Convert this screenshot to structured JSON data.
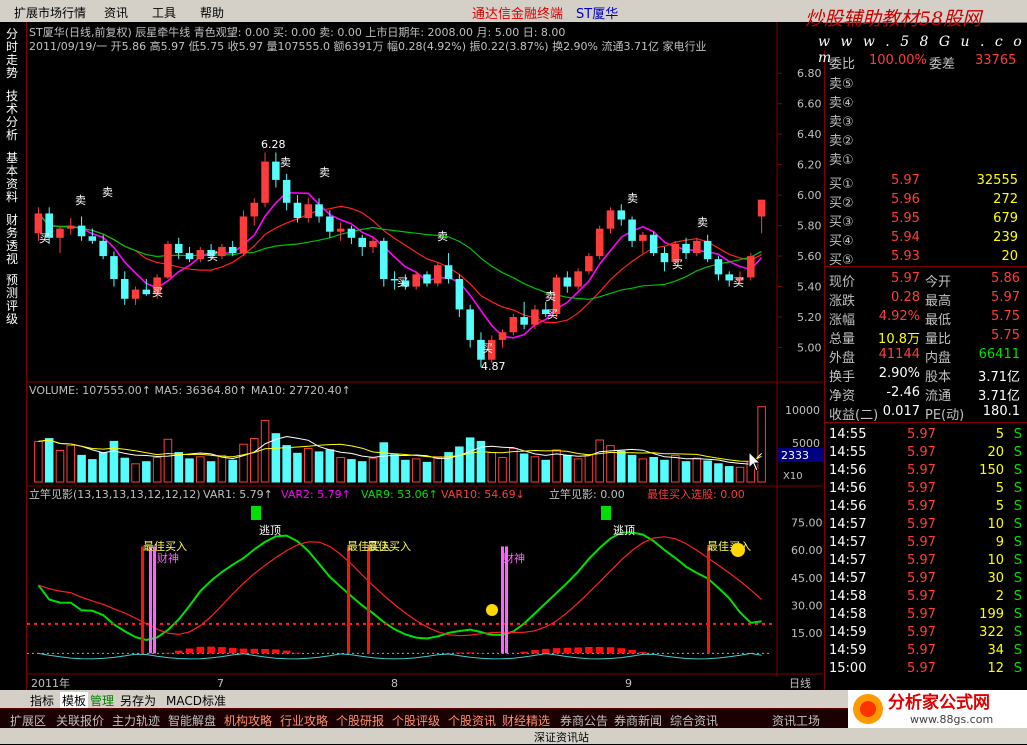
{
  "menu": {
    "items": [
      "扩展市场行情",
      "资讯",
      "工具",
      "帮助"
    ],
    "brand": "通达信金融终端",
    "stock": "ST厦华"
  },
  "watermark": {
    "top": "炒股辅助教材58股网",
    "url": "w w w . 5 8 G u . c o m"
  },
  "side_tabs": [
    "分时走势",
    "技术分析",
    "基本资料",
    "财务透视",
    "预测评级"
  ],
  "chart_header": {
    "line1": "ST厦华(日线,前复权) 辰星牵牛线  青色观望: 0.00  买: 0.00  卖: 0.00  上市日期年: 2008.00  月: 5.00  日: 8.00",
    "line2": "2011/09/19/一  开5.86 高5.97 低5.75 收5.97 量107555.0 额6391万 幅0.28(4.92%) 振0.22(3.87%) 换2.90% 流通3.71亿 家电行业"
  },
  "chart_annotations": {
    "buy": "买",
    "sell": "卖",
    "high_label": "6.28",
    "low_label": "4.87"
  },
  "price_axis": [
    "6.80",
    "6.60",
    "6.40",
    "6.20",
    "6.00",
    "5.80",
    "5.60",
    "5.40",
    "5.20",
    "5.00"
  ],
  "volume_header": "VOLUME: 107555.00↑  MA5: 36364.80↑  MA10: 27720.40↑",
  "volume_axis": {
    "top": "10000",
    "mid": "5000",
    "cursor": "2333",
    "unit": "X10"
  },
  "indicator_header": {
    "name": "立竿见影(13,13,13,13,12,12,12)",
    "var1": "VAR1: 5.79↑",
    "var2": "VAR2: 5.79↑",
    "var9": "VAR9: 53.06↑",
    "var10": "VAR10: 54.69↓",
    "ligan": "立竿见影: 0.00",
    "best": "最佳买入选股: 0.00"
  },
  "indicator_axis": [
    "75.00",
    "60.00",
    "45.00",
    "30.00",
    "15.00"
  ],
  "indicator_labels": {
    "best_buy": "最佳买入",
    "escape": "逃顶",
    "rich": "财神"
  },
  "time_axis": {
    "year": "2011年",
    "m7": "7",
    "m8": "8",
    "m9": "9",
    "period": "日线"
  },
  "orderbook": {
    "top_label": "委比",
    "top_value": "100.00%",
    "diff_label": "委差",
    "diff_value": "33765",
    "sell": [
      {
        "label": "卖⑤"
      },
      {
        "label": "卖④"
      },
      {
        "label": "卖③"
      },
      {
        "label": "卖②"
      },
      {
        "label": "卖①"
      }
    ],
    "buy": [
      {
        "label": "买①",
        "price": "5.97",
        "vol": "32555"
      },
      {
        "label": "买②",
        "price": "5.96",
        "vol": "272"
      },
      {
        "label": "买③",
        "price": "5.95",
        "vol": "679"
      },
      {
        "label": "买④",
        "price": "5.94",
        "vol": "239"
      },
      {
        "label": "买⑤",
        "price": "5.93",
        "vol": "20"
      }
    ]
  },
  "quote": [
    {
      "l1": "现价",
      "v1": "5.97",
      "c1": "red",
      "l2": "今开",
      "v2": "5.86",
      "c2": "red"
    },
    {
      "l1": "涨跌",
      "v1": "0.28",
      "c1": "red",
      "l2": "最高",
      "v2": "5.97",
      "c2": "red"
    },
    {
      "l1": "涨幅",
      "v1": "4.92%",
      "c1": "red",
      "l2": "最低",
      "v2": "5.75",
      "c2": "red"
    },
    {
      "l1": "总量",
      "v1": "10.8万",
      "c1": "yel",
      "l2": "量比",
      "v2": "5.75",
      "c2": "red"
    },
    {
      "l1": "外盘",
      "v1": "41144",
      "c1": "red",
      "l2": "内盘",
      "v2": "66411",
      "c2": "grn"
    },
    {
      "l1": "换手",
      "v1": "2.90%",
      "c1": "wht",
      "l2": "股本",
      "v2": "3.71亿",
      "c2": "wht"
    },
    {
      "l1": "净资",
      "v1": "-2.46",
      "c1": "wht",
      "l2": "流通",
      "v2": "3.71亿",
      "c2": "wht"
    },
    {
      "l1": "收益(二)",
      "v1": "0.017",
      "c1": "wht",
      "l2": "PE(动)",
      "v2": "180.1",
      "c2": "wht"
    }
  ],
  "ticks": [
    {
      "t": "14:55",
      "p": "5.97",
      "v": "5",
      "s": "S"
    },
    {
      "t": "14:55",
      "p": "5.97",
      "v": "20",
      "s": "S"
    },
    {
      "t": "14:56",
      "p": "5.97",
      "v": "150",
      "s": "S"
    },
    {
      "t": "14:56",
      "p": "5.97",
      "v": "5",
      "s": "S"
    },
    {
      "t": "14:56",
      "p": "5.97",
      "v": "5",
      "s": "S"
    },
    {
      "t": "14:57",
      "p": "5.97",
      "v": "10",
      "s": "S"
    },
    {
      "t": "14:57",
      "p": "5.97",
      "v": "9",
      "s": "S"
    },
    {
      "t": "14:57",
      "p": "5.97",
      "v": "10",
      "s": "S"
    },
    {
      "t": "14:57",
      "p": "5.97",
      "v": "30",
      "s": "S"
    },
    {
      "t": "14:58",
      "p": "5.97",
      "v": "2",
      "s": "S"
    },
    {
      "t": "14:58",
      "p": "5.97",
      "v": "199",
      "s": "S"
    },
    {
      "t": "14:59",
      "p": "5.97",
      "v": "322",
      "s": "S"
    },
    {
      "t": "14:59",
      "p": "5.97",
      "v": "34",
      "s": "S"
    },
    {
      "t": "15:00",
      "p": "5.97",
      "v": "12",
      "s": "S"
    }
  ],
  "bottom_tabs": [
    "指标",
    "模板",
    "管理",
    "另存为",
    "MACD标准"
  ],
  "nav": [
    "扩展区",
    "关联报价",
    "主力轨迹",
    "智能解盘",
    "机构攻略",
    "行业攻略",
    "个股研报",
    "个股评级",
    "个股资讯",
    "财经精选",
    "券商公告",
    "券商新闻",
    "综合资讯",
    "资讯工场"
  ],
  "status": "深证资讯站",
  "logo": {
    "text": "分析家公式网",
    "url": "www.88gs.com"
  },
  "colors": {
    "up": "#ff3c3c",
    "down": "#54fcfc",
    "ma1": "#ff00ff",
    "ma2": "#00c000",
    "ma3": "#ff2020",
    "frame": "#800000"
  },
  "chart_data": {
    "type": "candlestick",
    "title": "ST厦华(日线,前复权)",
    "ylim": [
      4.8,
      6.9
    ],
    "candles": [
      [
        5.75,
        5.92,
        5.7,
        5.88
      ],
      [
        5.88,
        5.92,
        5.68,
        5.72
      ],
      [
        5.72,
        5.8,
        5.62,
        5.78
      ],
      [
        5.78,
        5.85,
        5.74,
        5.8
      ],
      [
        5.8,
        5.86,
        5.7,
        5.73
      ],
      [
        5.73,
        5.78,
        5.68,
        5.7
      ],
      [
        5.7,
        5.74,
        5.58,
        5.6
      ],
      [
        5.6,
        5.63,
        5.4,
        5.45
      ],
      [
        5.45,
        5.5,
        5.28,
        5.32
      ],
      [
        5.32,
        5.4,
        5.28,
        5.38
      ],
      [
        5.38,
        5.45,
        5.34,
        5.35
      ],
      [
        5.35,
        5.48,
        5.32,
        5.46
      ],
      [
        5.46,
        5.7,
        5.45,
        5.68
      ],
      [
        5.68,
        5.72,
        5.58,
        5.62
      ],
      [
        5.62,
        5.66,
        5.56,
        5.58
      ],
      [
        5.58,
        5.66,
        5.56,
        5.64
      ],
      [
        5.64,
        5.68,
        5.58,
        5.6
      ],
      [
        5.6,
        5.68,
        5.58,
        5.66
      ],
      [
        5.66,
        5.7,
        5.6,
        5.62
      ],
      [
        5.62,
        5.9,
        5.6,
        5.86
      ],
      [
        5.86,
        5.98,
        5.8,
        5.95
      ],
      [
        5.95,
        6.28,
        5.92,
        6.22
      ],
      [
        6.22,
        6.28,
        6.05,
        6.1
      ],
      [
        6.1,
        6.14,
        5.9,
        5.95
      ],
      [
        5.95,
        6.0,
        5.82,
        5.85
      ],
      [
        5.85,
        5.98,
        5.82,
        5.94
      ],
      [
        5.94,
        5.98,
        5.82,
        5.86
      ],
      [
        5.86,
        5.9,
        5.72,
        5.76
      ],
      [
        5.76,
        5.82,
        5.7,
        5.78
      ],
      [
        5.78,
        5.8,
        5.68,
        5.72
      ],
      [
        5.72,
        5.74,
        5.6,
        5.66
      ],
      [
        5.66,
        5.72,
        5.62,
        5.7
      ],
      [
        5.7,
        5.72,
        5.4,
        5.45
      ],
      [
        5.45,
        5.5,
        5.38,
        5.44
      ],
      [
        5.44,
        5.48,
        5.38,
        5.4
      ],
      [
        5.4,
        5.5,
        5.38,
        5.48
      ],
      [
        5.48,
        5.5,
        5.4,
        5.42
      ],
      [
        5.42,
        5.56,
        5.4,
        5.54
      ],
      [
        5.54,
        5.62,
        5.42,
        5.45
      ],
      [
        5.45,
        5.48,
        5.2,
        5.25
      ],
      [
        5.25,
        5.28,
        5.0,
        5.05
      ],
      [
        5.05,
        5.1,
        4.87,
        4.92
      ],
      [
        4.92,
        5.08,
        4.9,
        5.05
      ],
      [
        5.05,
        5.12,
        5.0,
        5.1
      ],
      [
        5.1,
        5.22,
        5.08,
        5.2
      ],
      [
        5.2,
        5.3,
        5.12,
        5.15
      ],
      [
        5.15,
        5.28,
        5.12,
        5.25
      ],
      [
        5.25,
        5.3,
        5.2,
        5.22
      ],
      [
        5.22,
        5.48,
        5.2,
        5.46
      ],
      [
        5.46,
        5.5,
        5.36,
        5.4
      ],
      [
        5.4,
        5.52,
        5.38,
        5.5
      ],
      [
        5.5,
        5.62,
        5.48,
        5.6
      ],
      [
        5.6,
        5.8,
        5.58,
        5.78
      ],
      [
        5.78,
        5.92,
        5.75,
        5.9
      ],
      [
        5.9,
        5.94,
        5.8,
        5.84
      ],
      [
        5.84,
        5.86,
        5.66,
        5.7
      ],
      [
        5.7,
        5.76,
        5.62,
        5.74
      ],
      [
        5.74,
        5.76,
        5.6,
        5.62
      ],
      [
        5.62,
        5.66,
        5.5,
        5.56
      ],
      [
        5.56,
        5.7,
        5.54,
        5.68
      ],
      [
        5.68,
        5.72,
        5.58,
        5.62
      ],
      [
        5.62,
        5.72,
        5.6,
        5.7
      ],
      [
        5.7,
        5.74,
        5.56,
        5.58
      ],
      [
        5.58,
        5.6,
        5.44,
        5.48
      ],
      [
        5.48,
        5.5,
        5.4,
        5.44
      ],
      [
        5.44,
        5.5,
        5.42,
        5.46
      ],
      [
        5.46,
        5.62,
        5.44,
        5.6
      ],
      [
        5.86,
        5.97,
        5.75,
        5.97
      ]
    ],
    "volume_top": 12000,
    "volumes": [
      5800,
      6200,
      4500,
      5200,
      3800,
      3200,
      4200,
      5800,
      3400,
      2600,
      2900,
      3500,
      6100,
      4200,
      3300,
      3600,
      2900,
      3800,
      3100,
      5400,
      6200,
      8800,
      6900,
      5200,
      4100,
      4800,
      4300,
      4600,
      3500,
      3200,
      2900,
      3400,
      5600,
      3900,
      3100,
      3300,
      2800,
      3600,
      4200,
      5000,
      6300,
      5800,
      4200,
      3500,
      4800,
      4000,
      3600,
      3100,
      4600,
      3800,
      3300,
      3900,
      6000,
      5200,
      4400,
      3800,
      3300,
      3500,
      3100,
      3800,
      2900,
      3400,
      3000,
      2600,
      2200,
      2100,
      2800,
      10755
    ],
    "ind_ylim": [
      -5,
      85
    ]
  }
}
